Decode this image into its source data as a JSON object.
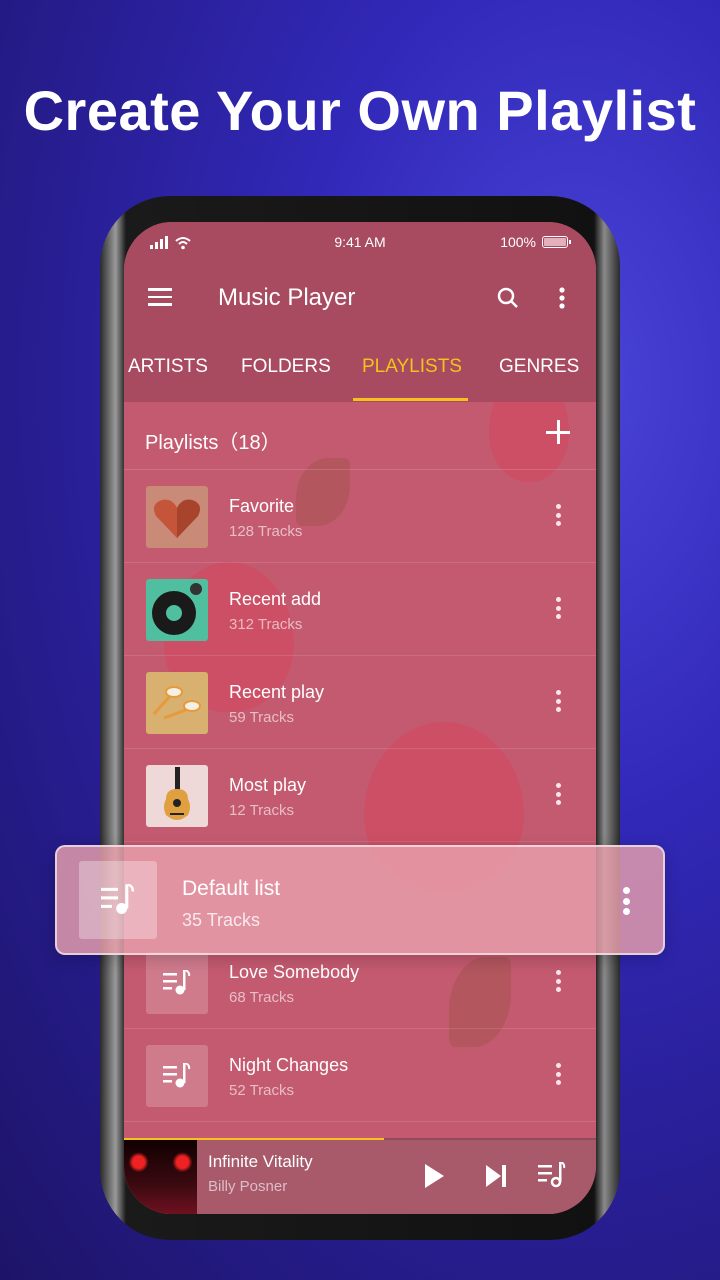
{
  "headline": "Create Your Own Playlist",
  "status": {
    "time": "9:41 AM",
    "battery": "100%"
  },
  "appbar": {
    "title": "Music Player",
    "menu_icon": "hamburger-menu-icon",
    "search_icon": "search-icon",
    "more_icon": "more-vert-icon"
  },
  "tabs": [
    {
      "label": "ARTISTS"
    },
    {
      "label": "FOLDERS"
    },
    {
      "label": "PLAYLISTS",
      "active": true
    },
    {
      "label": "GENRES"
    }
  ],
  "playlists_header": {
    "label": "Playlists（18）",
    "add_icon": "plus-icon"
  },
  "playlists": [
    {
      "name": "Favorite",
      "count": "128 Tracks",
      "thumb": "heart-art"
    },
    {
      "name": "Recent add",
      "count": "312 Tracks",
      "thumb": "turntable-art"
    },
    {
      "name": "Recent play",
      "count": "59 Tracks",
      "thumb": "earphones-art"
    },
    {
      "name": "Most play",
      "count": "12 Tracks",
      "thumb": "guitar-art"
    },
    {
      "name": "Default list",
      "count": "35 Tracks",
      "thumb": "playlist-icon",
      "highlighted": true
    },
    {
      "name": "Love Somebody",
      "count": "68 Tracks",
      "thumb": "playlist-icon"
    },
    {
      "name": "Night Changes",
      "count": "52 Tracks",
      "thumb": "playlist-icon"
    }
  ],
  "now_playing": {
    "title": "Infinite Vitality",
    "artist": "Billy Posner",
    "progress_percent": 55
  },
  "colors": {
    "accent": "#f3c21c",
    "appbar": "#a84b60",
    "list_bg": "#c45a70",
    "background": "#3128b8"
  }
}
